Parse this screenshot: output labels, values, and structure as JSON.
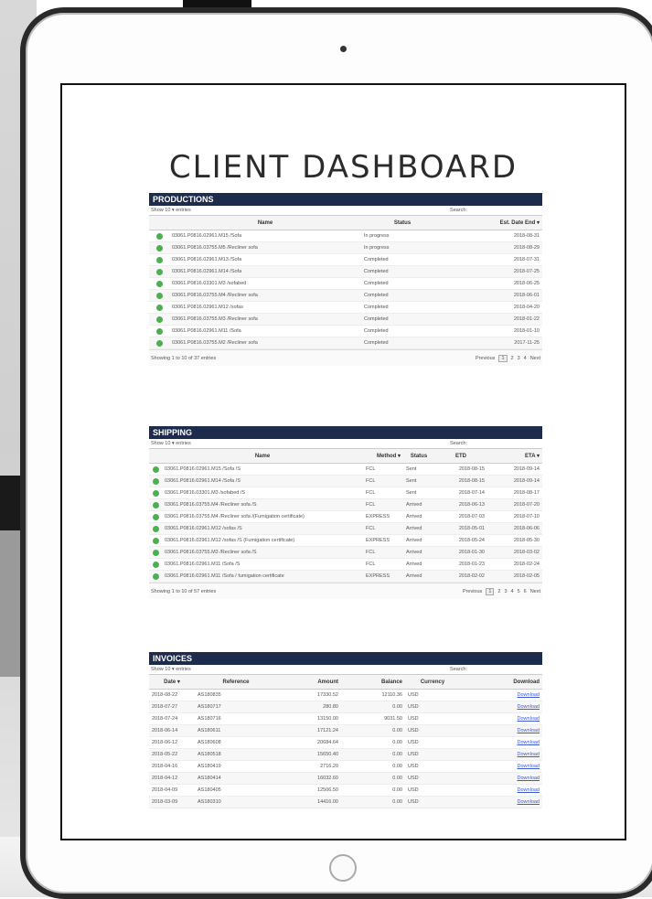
{
  "title": "CLIENT DASHBOARD",
  "productions": {
    "header": "PRODUCTIONS",
    "show": "Show 10 ▾ entries",
    "search": "Search:",
    "columns": [
      "",
      "Name",
      "Status",
      "Est. Date End ▾"
    ],
    "rows": [
      [
        "03061.P0816.02961.M15 /Sofa",
        "In progress",
        "2018-08-31"
      ],
      [
        "03061.P0816.03755.M5 /Recliner sofa",
        "In progress",
        "2018-08-29"
      ],
      [
        "03061.P0816.02961.M13 /Sofa",
        "Completed",
        "2018-07-31"
      ],
      [
        "03061.P0816.02961.M14 /Sofa",
        "Completed",
        "2018-07-25"
      ],
      [
        "03061.P0816.03301.M3 /sofabed",
        "Completed",
        "2018-06-25"
      ],
      [
        "03061.P0816.03755.M4 /Recliner sofa",
        "Completed",
        "2018-06-01"
      ],
      [
        "03061.P0816.02961.M12 /sofas",
        "Completed",
        "2018-04-20"
      ],
      [
        "03061.P0816.03755.M3 /Recliner sofa",
        "Completed",
        "2018-01-22"
      ],
      [
        "03061.P0816.02961.M11 /Sofa",
        "Completed",
        "2018-01-10"
      ],
      [
        "03061.P0816.03755.M2 /Recliner sofa",
        "Completed",
        "2017-11-25"
      ]
    ],
    "info": "Showing 1 to 10 of 37 entries",
    "pager": [
      "Previous",
      "1",
      "2",
      "3",
      "4",
      "Next"
    ]
  },
  "shipping": {
    "header": "SHIPPING",
    "show": "Show 10 ▾ entries",
    "search": "Search:",
    "columns": [
      "",
      "Name",
      "Method ▾",
      "Status",
      "ETD",
      "ETA ▾"
    ],
    "rows": [
      [
        "03061.P0816.02961.M15 /Sofa /S",
        "FCL",
        "Sent",
        "2018-08-15",
        "2018-09-14"
      ],
      [
        "03061.P0816.02961.M14 /Sofa /S",
        "FCL",
        "Sent",
        "2018-08-15",
        "2018-09-14"
      ],
      [
        "03061.P0816.03301.M3 /sofabed /S",
        "FCL",
        "Sent",
        "2018-07-14",
        "2018-08-17"
      ],
      [
        "03061.P0816.03755.M4 /Recliner sofa /S",
        "FCL",
        "Arrived",
        "2018-06-13",
        "2018-07-20"
      ],
      [
        "03061.P0816.03755.M4 /Recliner sofa /(Fumigation certificate)",
        "EXPRESS",
        "Arrived",
        "2018-07-03",
        "2018-07-10"
      ],
      [
        "03061.P0816.02961.M12 /sofas /S",
        "FCL",
        "Arrived",
        "2018-05-01",
        "2018-06-06"
      ],
      [
        "03061.P0816.02961.M12 /sofas /S (Fumigation certificate)",
        "EXPRESS",
        "Arrived",
        "2018-05-24",
        "2018-05-30"
      ],
      [
        "03061.P0816.03755.M3 /Recliner sofa /S",
        "FCL",
        "Arrived",
        "2018-01-30",
        "2018-03-02"
      ],
      [
        "03061.P0816.02961.M11 /Sofa /S",
        "FCL",
        "Arrived",
        "2018-01-23",
        "2018-02-24"
      ],
      [
        "03061.P0816.02961.M11 /Sofa / fumigation certificate",
        "EXPRESS",
        "Arrived",
        "2018-02-02",
        "2018-02-05"
      ]
    ],
    "info": "Showing 1 to 10 of 57 entries",
    "pager": [
      "Previous",
      "1",
      "2",
      "3",
      "4",
      "5",
      "6",
      "Next"
    ]
  },
  "invoices": {
    "header": "INVOICES",
    "show": "Show 10 ▾ entries",
    "search": "Search:",
    "columns": [
      "Date ▾",
      "Reference",
      "Amount",
      "Balance",
      "Currency",
      "Download"
    ],
    "rows": [
      [
        "2018-08-22",
        "AS180835",
        "17330.52",
        "12110.36",
        "USD",
        "Download"
      ],
      [
        "2018-07-27",
        "AS180717",
        "280.80",
        "0.00",
        "USD",
        "Download"
      ],
      [
        "2018-07-24",
        "AS180716",
        "13150.00",
        "9031.50",
        "USD",
        "Download"
      ],
      [
        "2018-06-14",
        "AS180611",
        "17121.24",
        "0.00",
        "USD",
        "Download"
      ],
      [
        "2018-06-12",
        "AS180608",
        "20684.64",
        "0.00",
        "USD",
        "Download"
      ],
      [
        "2018-05-22",
        "AS180518",
        "15650.40",
        "0.00",
        "USD",
        "Download"
      ],
      [
        "2018-04-16",
        "AS180419",
        "2716.20",
        "0.00",
        "USD",
        "Download"
      ],
      [
        "2018-04-12",
        "AS180414",
        "16032.60",
        "0.00",
        "USD",
        "Download"
      ],
      [
        "2018-04-09",
        "AS180405",
        "12506.50",
        "0.00",
        "USD",
        "Download"
      ],
      [
        "2018-03-09",
        "AS180310",
        "14416.00",
        "0.00",
        "USD",
        "Download"
      ]
    ]
  }
}
